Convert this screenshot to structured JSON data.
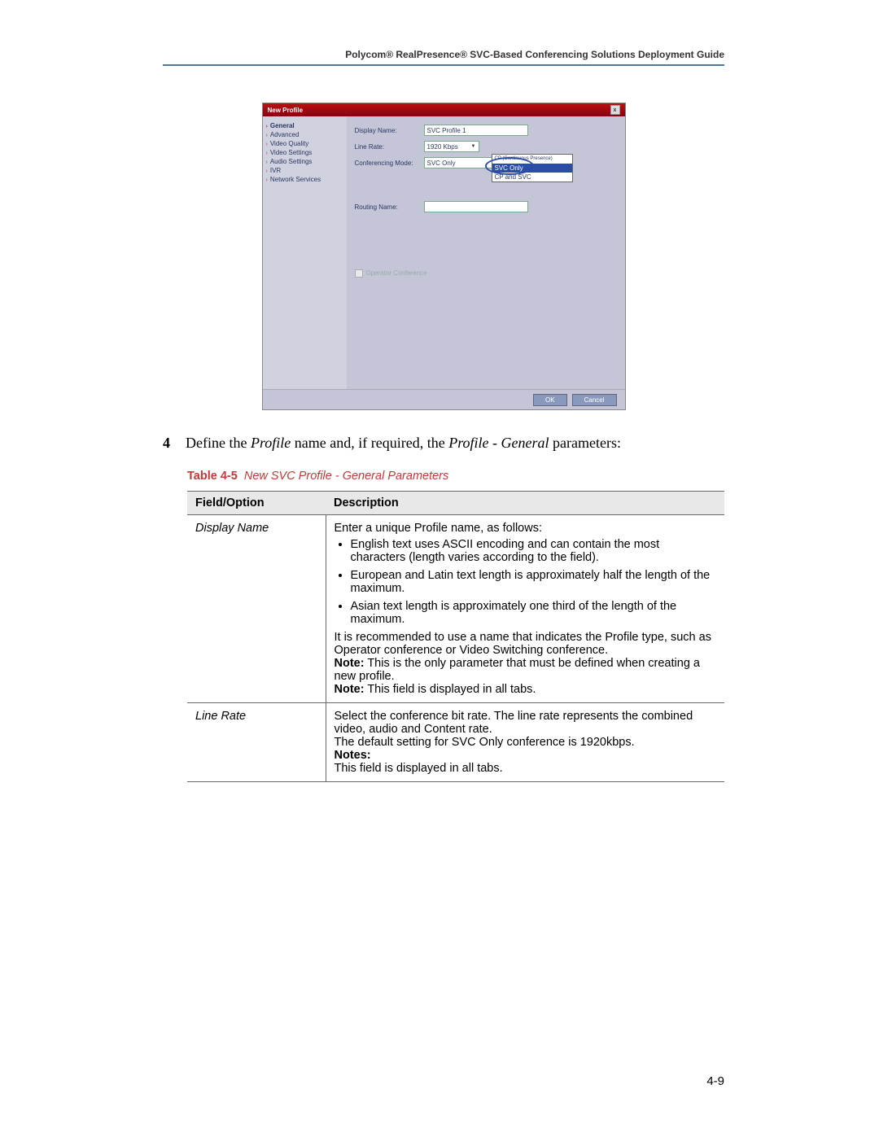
{
  "header": "Polycom® RealPresence® SVC-Based Conferencing Solutions Deployment Guide",
  "page_number": "4-9",
  "dialog": {
    "title": "New Profile",
    "close": "x",
    "nav": [
      "General",
      "Advanced",
      "Video Quality",
      "Video Settings",
      "Audio Settings",
      "IVR",
      "Network Services"
    ],
    "labels": {
      "display": "Display Name:",
      "rate": "Line Rate:",
      "mode": "Conferencing Mode:",
      "routing": "Routing Name:",
      "chk": "Operator Conference"
    },
    "values": {
      "display": "SVC Profile 1",
      "rate": "1920 Kbps",
      "mode": "SVC Only"
    },
    "dropdown": [
      "CP (Continuous Presence)",
      "SVC Only",
      "CP and SVC"
    ],
    "buttons": {
      "ok": "OK",
      "cancel": "Cancel"
    }
  },
  "step": {
    "num": "4",
    "t1": "Define the ",
    "i1": "Profile",
    "t2": " name and, if required, the ",
    "i2": "Profile - General",
    "t3": " parameters:"
  },
  "caption": {
    "prefix": "Table 4-5",
    "title": "New SVC Profile - General Parameters"
  },
  "table": {
    "h1": "Field/Option",
    "h2": "Description",
    "r1f": "Display Name",
    "r1": {
      "intro": "Enter a unique Profile name, as follows:",
      "b1": "English text uses ASCII encoding and can contain the most characters (length varies according to the field).",
      "b2": "European and Latin text length is approximately half the length of the maximum.",
      "b3": "Asian text length is approximately one third of the length of the maximum.",
      "rec": "It is recommended to use a name that indicates the Profile type, such as Operator conference or Video Switching conference.",
      "n1l": "Note:",
      "n1": " This is the only parameter that must be defined when creating a new profile.",
      "n2l": "Note:",
      "n2": " This field is displayed in all tabs."
    },
    "r2f": "Line Rate",
    "r2": {
      "p1": "Select the conference bit rate. The line rate represents the combined video, audio and Content rate.",
      "p2": "The default setting for SVC Only conference is 1920kbps.",
      "nl": "Notes:",
      "p3": "This field is displayed in all tabs."
    }
  }
}
